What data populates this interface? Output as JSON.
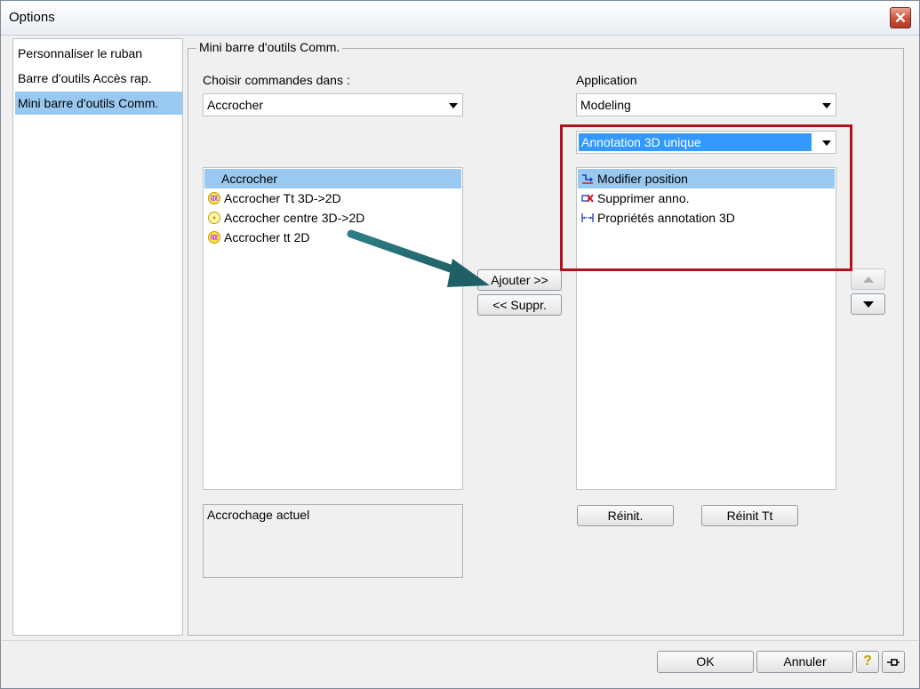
{
  "window": {
    "title": "Options",
    "close_glyph": "✕"
  },
  "nav": {
    "items": [
      {
        "label": "Personnaliser le ruban"
      },
      {
        "label": "Barre d'outils Accès rap."
      },
      {
        "label": "Mini barre d'outils Comm."
      }
    ]
  },
  "group": {
    "title": "Mini barre d'outils Comm."
  },
  "left": {
    "choose_label": "Choisir commandes dans :",
    "combo_value": "Accrocher",
    "list": [
      {
        "label": "Accrocher",
        "icon": "none"
      },
      {
        "label": "Accrocher Tt 3D->2D",
        "icon": "snap-3d-icon"
      },
      {
        "label": "Accrocher centre 3D->2D",
        "icon": "snap-center-icon"
      },
      {
        "label": "Accrocher tt 2D",
        "icon": "snap-2d-icon"
      }
    ],
    "current_label": "Accrochage actuel"
  },
  "middle": {
    "add_label": "Ajouter >>",
    "remove_label": "<< Suppr."
  },
  "right": {
    "app_label": "Application",
    "app_value": "Modeling",
    "context_value": "Annotation 3D unique",
    "list": [
      {
        "label": "Modifier position",
        "icon": "modify-position-icon"
      },
      {
        "label": "Supprimer anno.",
        "icon": "delete-annotation-icon"
      },
      {
        "label": "Propriétés annotation 3D",
        "icon": "annotation-properties-icon"
      }
    ],
    "reset_label": "Réinit.",
    "reset_all_label": "Réinit Tt"
  },
  "footer": {
    "ok_label": "OK",
    "cancel_label": "Annuler",
    "help_glyph": "?"
  },
  "colors": {
    "selection": "#99c9f0",
    "highlight": "#3399ff",
    "annotation_red": "#b0121b",
    "arrow_teal": "#1f5f66"
  }
}
